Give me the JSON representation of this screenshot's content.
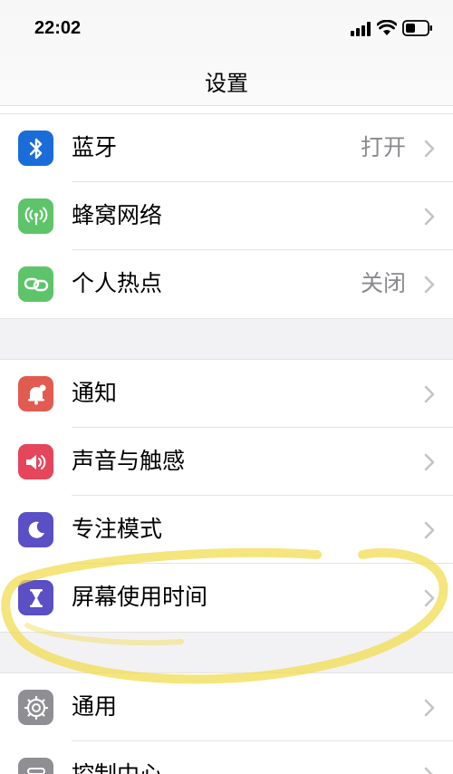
{
  "status_bar": {
    "time": "22:02"
  },
  "nav": {
    "title": "设置"
  },
  "groups": [
    [
      {
        "label": "蓝牙",
        "value": "打开",
        "icon": "bluetooth-icon",
        "color": "#1a6dd8"
      },
      {
        "label": "蜂窝网络",
        "value": "",
        "icon": "cellular-icon",
        "color": "#5ec46a"
      },
      {
        "label": "个人热点",
        "value": "关闭",
        "icon": "hotspot-icon",
        "color": "#5ec46a"
      }
    ],
    [
      {
        "label": "通知",
        "value": "",
        "icon": "notification-icon",
        "color": "#e25b50"
      },
      {
        "label": "声音与触感",
        "value": "",
        "icon": "sound-icon",
        "color": "#e5465c"
      },
      {
        "label": "专注模式",
        "value": "",
        "icon": "moon-icon",
        "color": "#5b4fc6"
      },
      {
        "label": "屏幕使用时间",
        "value": "",
        "icon": "hourglass-icon",
        "color": "#5b4fc6"
      }
    ],
    [
      {
        "label": "通用",
        "value": "",
        "icon": "gear-icon",
        "color": "#8e8e93"
      },
      {
        "label": "控制中心",
        "value": "",
        "icon": "control-center-icon",
        "color": "#8e8e93"
      }
    ]
  ]
}
